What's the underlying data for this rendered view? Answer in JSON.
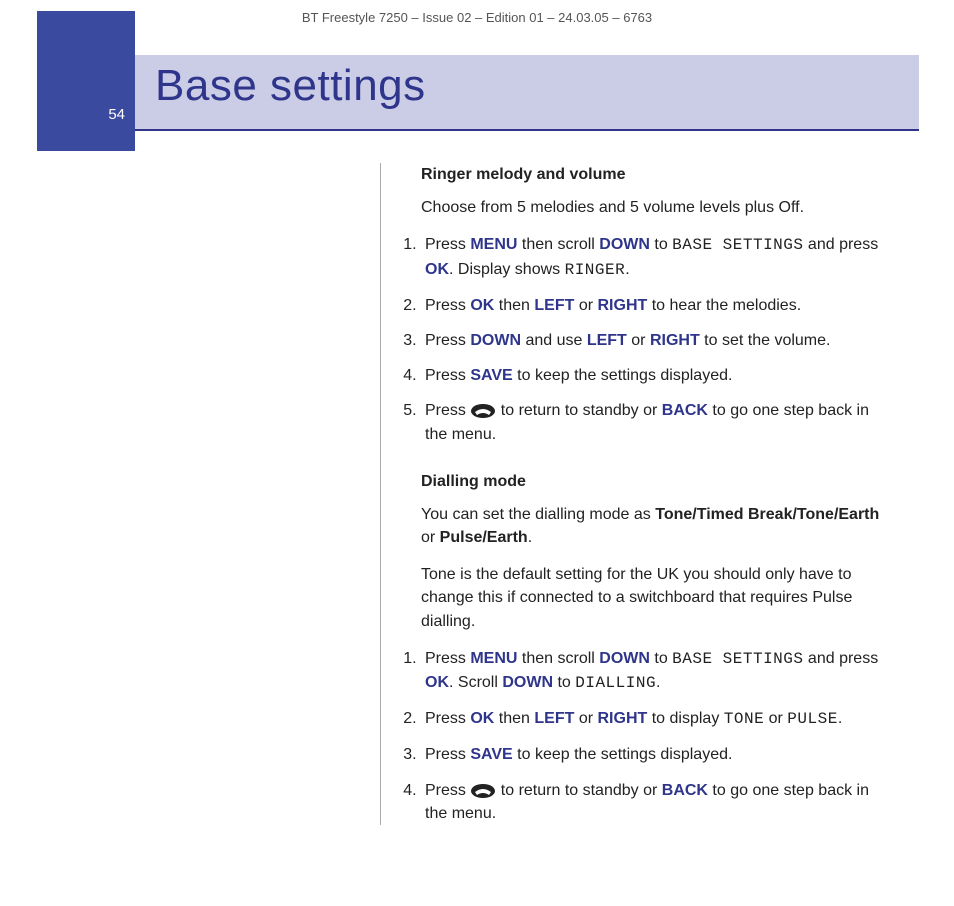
{
  "header": {
    "doc_id": "BT Freestyle 7250 – Issue 02 – Edition 01 – 24.03.05 – 6763"
  },
  "title": {
    "page_number": "54",
    "text": "Base settings"
  },
  "sections": {
    "ringer": {
      "heading": "Ringer melody and volume",
      "intro": "Choose from 5 melodies and 5 volume levels plus Off.",
      "steps": [
        {
          "pre1": "Press ",
          "kw1": "MENU",
          "mid1": " then scroll ",
          "kw2": "DOWN",
          "mid2": " to ",
          "lcd1": "BASE SETTINGS",
          "mid3": " and press ",
          "kw3": "OK",
          "mid4": ". Display shows ",
          "lcd2": "RINGER",
          "post": "."
        },
        {
          "pre1": "Press ",
          "kw1": "OK",
          "mid1": " then ",
          "kw2": "LEFT",
          "mid2": " or ",
          "kw3": "RIGHT",
          "post": " to hear the melodies."
        },
        {
          "pre1": "Press ",
          "kw1": "DOWN",
          "mid1": " and use ",
          "kw2": "LEFT",
          "mid2": " or ",
          "kw3": "RIGHT",
          "post": " to set the volume."
        },
        {
          "pre1": "Press ",
          "kw1": "SAVE",
          "post": " to keep the settings displayed."
        },
        {
          "pre1": "Press ",
          "icon": "hangup",
          "mid1": " to return to standby or ",
          "kw1": "BACK",
          "post": " to go one step back in the menu."
        }
      ]
    },
    "dialling": {
      "heading": "Dialling mode",
      "intro_parts": {
        "p1": "You can set the dialling mode as ",
        "b1": "Tone/Timed Break/Tone/Earth",
        "p2": " or ",
        "b2": "Pulse/Earth",
        "p3": "."
      },
      "note": "Tone is the default setting for the UK you should only have to change this if connected to a switchboard that requires Pulse dialling.",
      "steps": [
        {
          "pre1": "Press ",
          "kw1": "MENU",
          "mid1": " then scroll ",
          "kw2": "DOWN",
          "mid2": " to ",
          "lcd1": "BASE SETTINGS",
          "mid3": " and press ",
          "kw3": "OK",
          "mid4": ". Scroll ",
          "kw4": "DOWN",
          "mid5": " to ",
          "lcd2": "DIALLING",
          "post": "."
        },
        {
          "pre1": "Press ",
          "kw1": "OK",
          "mid1": " then ",
          "kw2": "LEFT",
          "mid2": " or ",
          "kw3": "RIGHT",
          "mid3": " to display ",
          "lcd1": "TONE",
          "mid4": " or ",
          "lcd2": "PULSE",
          "post": "."
        },
        {
          "pre1": "Press ",
          "kw1": "SAVE",
          "post": " to keep the settings displayed."
        },
        {
          "pre1": "Press ",
          "icon": "hangup",
          "mid1": " to return to standby or ",
          "kw1": "BACK",
          "post": " to go one step back in the menu."
        }
      ]
    }
  }
}
